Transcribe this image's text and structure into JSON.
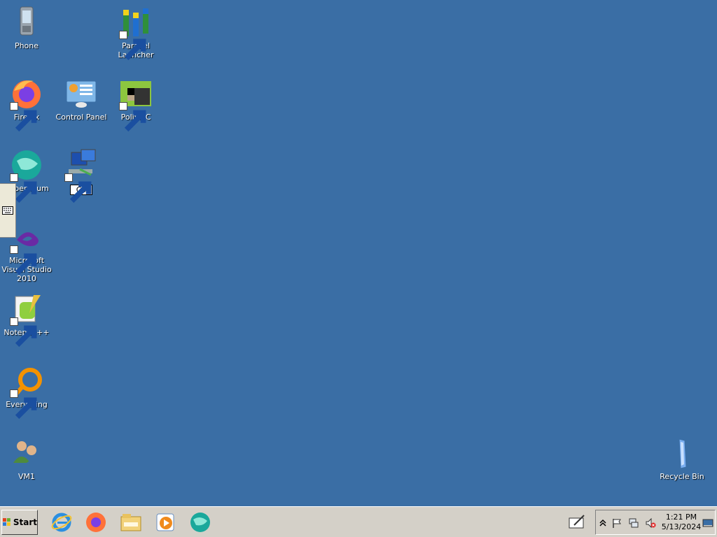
{
  "desktop": {
    "icons": {
      "phone": "Phone",
      "parallel_launcher": "Parallel Launcher",
      "firefox": "Firefox",
      "control_panel": "Control Panel",
      "pollymc": "PollyMC",
      "supermium": "permium",
      "network_rename": "Co",
      "msvs": "Microsoft Visual Studio 2010",
      "notepadpp": "Notepad++",
      "everything": "Everything",
      "vm1": "VM1",
      "recycle_bin": "Recycle Bin"
    }
  },
  "taskbar": {
    "start_label": "Start",
    "quicklaunch": [
      "ie-icon",
      "firefox-icon",
      "explorer-icon",
      "media-player-icon",
      "supermium-icon"
    ],
    "tray": {
      "time": "1:21 PM",
      "date": "5/13/2024",
      "icons": [
        "show-hidden-icon",
        "action-center-flag-icon",
        "network-icon",
        "volume-muted-icon",
        "show-desktop-icon"
      ]
    }
  },
  "colors": {
    "desktop_bg": "#3a6ea5",
    "taskbar_bg": "#d4d0c8"
  }
}
